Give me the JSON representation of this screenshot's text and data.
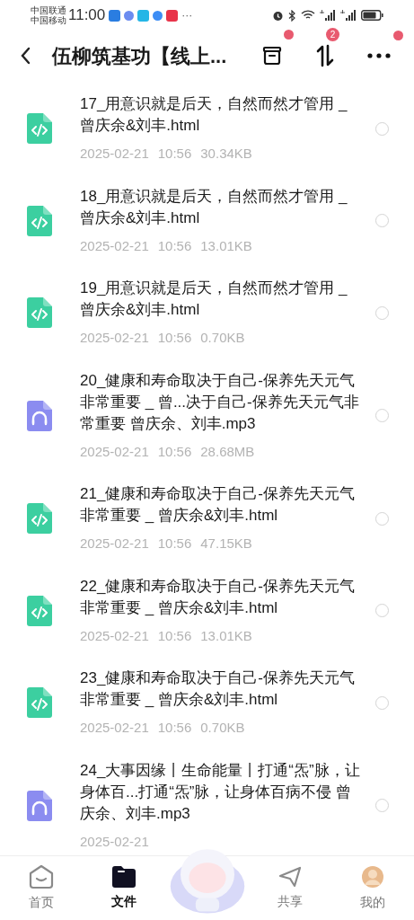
{
  "status_bar": {
    "carriers": [
      "中国联通",
      "中国移动"
    ],
    "time": "11:00",
    "more": "···"
  },
  "header": {
    "title": "伍柳筑基功【线上...",
    "archive_dot": true,
    "sort_badge": "2",
    "more_dot": true
  },
  "files": [
    {
      "kind": "html",
      "name": "17_用意识就是后天，自然而然才管用 _ 曾庆余&刘丰.html",
      "date": "2025-02-21",
      "time": "10:56",
      "size": "30.34KB",
      "selected": false
    },
    {
      "kind": "html",
      "name": "18_用意识就是后天，自然而然才管用 _ 曾庆余&刘丰.html",
      "date": "2025-02-21",
      "time": "10:56",
      "size": "13.01KB",
      "selected": false
    },
    {
      "kind": "html",
      "name": "19_用意识就是后天，自然而然才管用 _ 曾庆余&刘丰.html",
      "date": "2025-02-21",
      "time": "10:56",
      "size": "0.70KB",
      "selected": false
    },
    {
      "kind": "audio",
      "name": "20_健康和寿命取决于自己-保养先天元气非常重要 _ 曾...决于自己-保养先天元气非常重要  曾庆余、刘丰.mp3",
      "date": "2025-02-21",
      "time": "10:56",
      "size": "28.68MB",
      "selected": false
    },
    {
      "kind": "html",
      "name": "21_健康和寿命取决于自己-保养先天元气非常重要 _ 曾庆余&刘丰.html",
      "date": "2025-02-21",
      "time": "10:56",
      "size": "47.15KB",
      "selected": false
    },
    {
      "kind": "html",
      "name": "22_健康和寿命取决于自己-保养先天元气非常重要 _ 曾庆余&刘丰.html",
      "date": "2025-02-21",
      "time": "10:56",
      "size": "13.01KB",
      "selected": false
    },
    {
      "kind": "html",
      "name": "23_健康和寿命取决于自己-保养先天元气非常重要 _ 曾庆余&刘丰.html",
      "date": "2025-02-21",
      "time": "10:56",
      "size": "0.70KB",
      "selected": false
    },
    {
      "kind": "audio",
      "name": "24_大事因缘丨生命能量丨打通“炁”脉，让身体百...打通“炁”脉，让身体百病不侵  曾庆余、刘丰.mp3",
      "date": "2025-02-21",
      "selected": false
    }
  ],
  "nav": [
    {
      "kind": "home",
      "label": "首页",
      "selected": false
    },
    {
      "kind": "folder",
      "label": "文件",
      "selected": true
    },
    {
      "kind": "share",
      "label": "共享",
      "selected": false
    },
    {
      "kind": "me",
      "label": "我的",
      "selected": false
    }
  ]
}
